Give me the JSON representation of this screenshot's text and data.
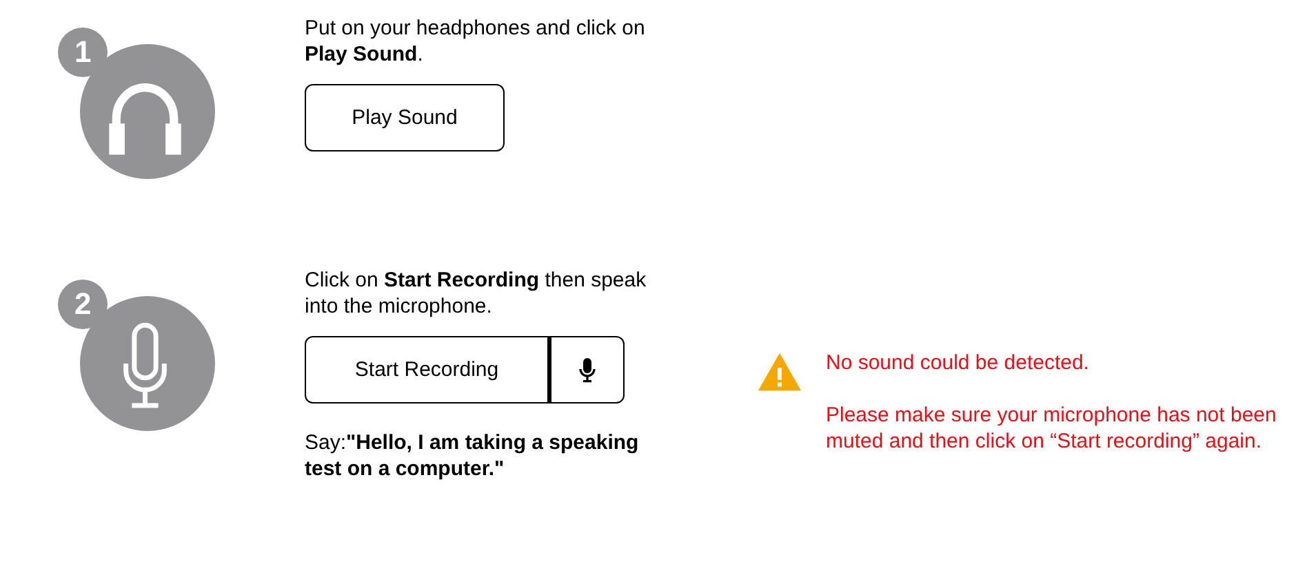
{
  "steps": [
    {
      "number": "1",
      "kind": "headphones",
      "instruction": "Put on your headphones and click on **Play Sound**.",
      "button": {
        "label": "Play Sound"
      }
    },
    {
      "number": "2",
      "kind": "microphone",
      "instruction": "Click on **Start Recording** then speak into the microphone.",
      "button": {
        "label": "Start Recording"
      },
      "mic_button": true,
      "prompt": "Say:**\"Hello, I am taking a speaking test on a computer.\"**",
      "alert": {
        "messages": [
          "No sound could be detected.",
          "Please make sure your microphone has not been muted and then click on “Start recording” again."
        ]
      }
    }
  ]
}
